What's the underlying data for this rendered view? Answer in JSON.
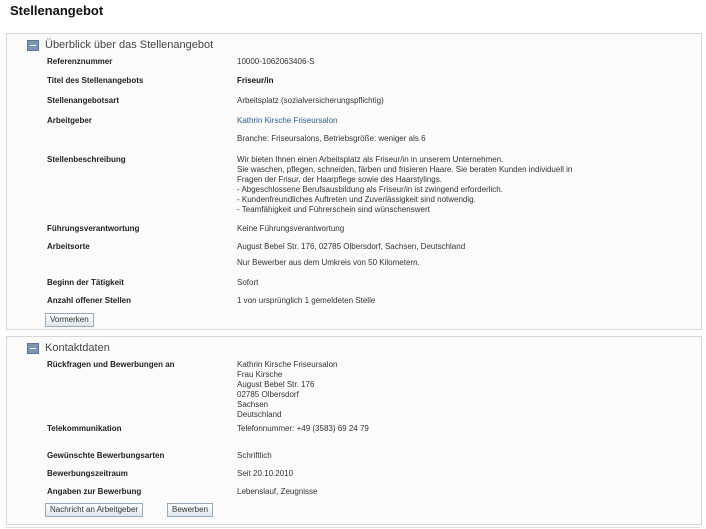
{
  "page": {
    "title": "Stellenangebot"
  },
  "overview": {
    "title": "Überblick über das Stellenangebot",
    "rows": {
      "referenznummer": {
        "label": "Referenznummer",
        "value": "10000-1062063406-S"
      },
      "titel": {
        "label": "Titel des Stellenangebots",
        "value": "Friseur/in"
      },
      "art": {
        "label": "Stellenangebotsart",
        "value": "Arbeitsplatz (sozialversicherungspflichtig)"
      },
      "arbeitgeber": {
        "label": "Arbeitgeber",
        "link": "Kathrin Kirsche Friseursalon",
        "extra": "Branche: Friseursalons, Betriebsgröße: weniger als 6"
      },
      "beschreibung": {
        "label": "Stellenbeschreibung",
        "lines": [
          "Wir bieten Ihnen einen Arbeitsplatz als Friseur/in in unserem Unternehmen.",
          "Sie waschen, pflegen, schneiden, färben und frisieren Haare. Sie beraten Kunden individuell in",
          "Fragen der Frisur, der Haarpflege sowie des Haarstylings.",
          "- Abgeschlossene Berufsausbildung als Friseur/in ist zwingend erforderlich.",
          "- Kundenfreundliches Auftreten und Zuverlässigkeit sind notwendig.",
          "- Teamfähigkeit und Führerschein sind wünschenswert"
        ]
      },
      "fuehrung": {
        "label": "Führungsverantwortung",
        "value": "Keine Führungsverantwortung"
      },
      "arbeitsorte": {
        "label": "Arbeitsorte",
        "value": "August Bebel Str. 176, 02785 Olbersdorf, Sachsen, Deutschland",
        "extra": "Nur Bewerber aus dem Umkreis von 50 Kilometern."
      },
      "beginn": {
        "label": "Beginn der Tätigkeit",
        "value": "Sofort"
      },
      "anzahl": {
        "label": "Anzahl offener Stellen",
        "value": "1 von ursprünglich 1 gemeldeten Stelle"
      }
    },
    "bookmark_button": "Vormerken"
  },
  "contact": {
    "title": "Kontaktdaten",
    "rows": {
      "rueckfragen": {
        "label": "Rückfragen und Bewerbungen an",
        "lines": [
          "Kathrin Kirsche Friseursalon",
          "Frau Kirsche",
          "August Bebel Str. 176",
          "02785 Olbersdorf",
          "Sachsen",
          "Deutschland"
        ]
      },
      "telekommunikation": {
        "label": "Telekommunikation",
        "value": "Telefonnummer: +49 (3583) 69 24 79"
      },
      "bewerbungsarten": {
        "label": "Gewünschte Bewerbungsarten",
        "value": "Schriftlich"
      },
      "zeitraum": {
        "label": "Bewerbungszeitraum",
        "value": "Seit 20.10.2010"
      },
      "angaben": {
        "label": "Angaben zur Bewerbung",
        "value": "Lebenslauf, Zeugnisse"
      }
    },
    "message_button": "Nachricht an Arbeitgeber",
    "apply_button": "Bewerben"
  }
}
